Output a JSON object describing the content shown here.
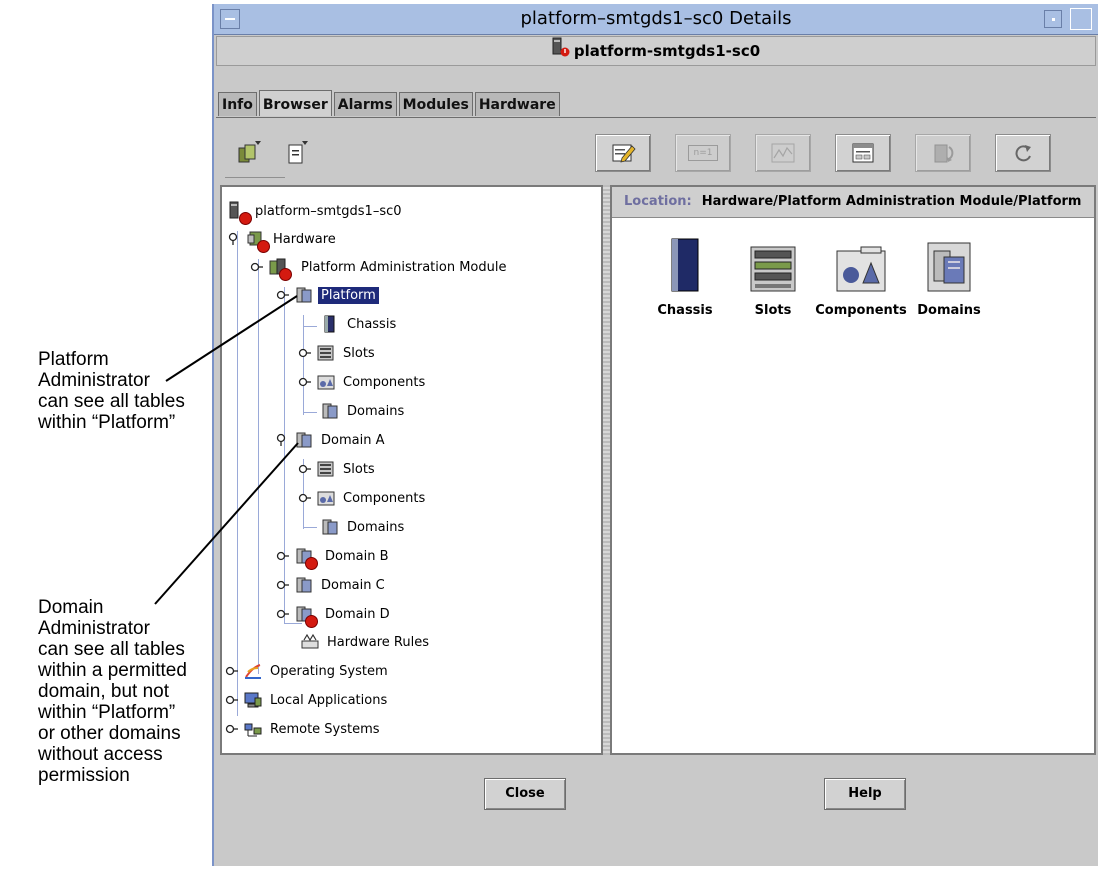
{
  "annotations": {
    "platform_admin": [
      "Platform",
      "Administrator",
      "can see all tables",
      "within “Platform”"
    ],
    "domain_admin": [
      "Domain",
      "Administrator",
      "can see all tables",
      "within a permitted",
      "domain, but not",
      "within “Platform”",
      "or other domains",
      "without access",
      "permission"
    ]
  },
  "window": {
    "title": "platform–smtgds1–sc0 Details",
    "subheader": "platform-smtgds1-sc0"
  },
  "tabs": [
    "Info",
    "Browser",
    "Alarms",
    "Modules",
    "Hardware"
  ],
  "active_tab": "Browser",
  "toolbar": {
    "small_icons": [
      "console-icon",
      "properties-icon"
    ],
    "buttons": [
      {
        "name": "edit",
        "icon": "edit-icon",
        "enabled": true
      },
      {
        "name": "nth",
        "label": "n=1",
        "enabled": false
      },
      {
        "name": "graph",
        "icon": "graph-icon",
        "enabled": false
      },
      {
        "name": "view",
        "icon": "table-icon",
        "enabled": true
      },
      {
        "name": "sync",
        "icon": "sync-icon",
        "enabled": false
      },
      {
        "name": "refresh",
        "icon": "refresh-icon",
        "enabled": true
      }
    ]
  },
  "tree": {
    "root": "platform–smtgds1–sc0",
    "hardware": "Hardware",
    "pam": "Platform Administration Module",
    "platform": "Platform",
    "chassis": "Chassis",
    "slots": "Slots",
    "components": "Components",
    "domains": "Domains",
    "domain_a": "Domain A",
    "da_slots": "Slots",
    "da_components": "Components",
    "da_domains": "Domains",
    "domain_b": "Domain B",
    "domain_c": "Domain C",
    "domain_d": "Domain D",
    "hw_rules": "Hardware Rules",
    "os": "Operating System",
    "local_apps": "Local Applications",
    "remote": "Remote Systems"
  },
  "location": {
    "label": "Location:",
    "path": "Hardware/Platform Administration Module/Platform"
  },
  "detail_items": [
    "Chassis",
    "Slots",
    "Components",
    "Domains"
  ],
  "buttons": {
    "close": "Close",
    "help": "Help"
  }
}
